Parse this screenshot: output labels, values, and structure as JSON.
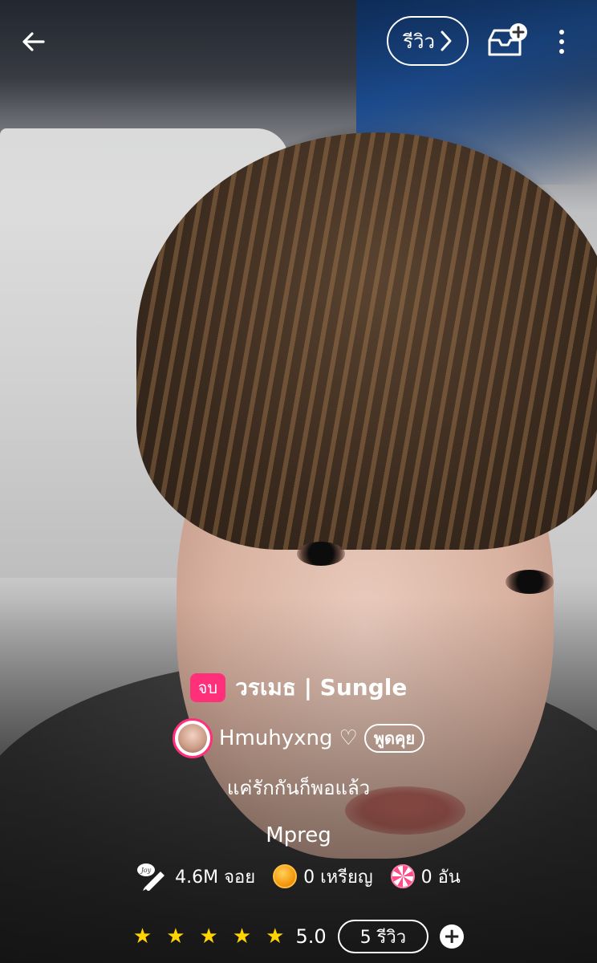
{
  "header": {
    "back_icon": "arrow-left-icon",
    "review_label": "รีวิว",
    "review_chevron_icon": "chevron-right-icon",
    "add_to_library_icon": "inbox-plus-icon",
    "more_icon": "kebab-menu-icon"
  },
  "story": {
    "status_badge": "จบ",
    "title": "วรเมธ | Sungle",
    "author_name": "Hmuhyxng",
    "author_heart": "♡",
    "chat_label": "พูดคุย",
    "tagline": "แค่รักกันก็พอแล้ว",
    "genre": "Mpreg"
  },
  "stats": {
    "joy_icon": "joy-pen-icon",
    "joy": "4.6M จอย",
    "coin_icon": "coin-icon",
    "coins": "0 เหรียญ",
    "candy_icon": "lollipop-icon",
    "candies": "0 อัน"
  },
  "rating": {
    "stars": [
      "★",
      "★",
      "★",
      "★",
      "★"
    ],
    "value": "5.0",
    "reviews_label": "5 รีวิว",
    "add_label": "+"
  },
  "colors": {
    "accent": "#ff2f7a",
    "star": "#ffd400"
  }
}
